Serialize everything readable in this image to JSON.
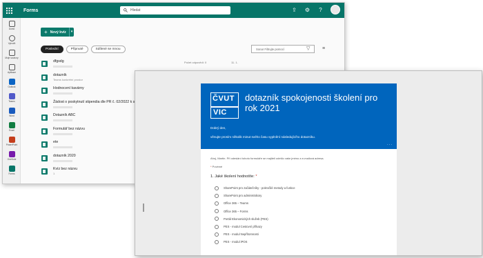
{
  "back_window": {
    "app_name": "Forms",
    "search_placeholder": "Hledat",
    "top_icons": [
      "share-icon",
      "gear-icon",
      "help-icon"
    ],
    "left_rail": [
      {
        "label": "Domů",
        "icon": "home-icon"
      },
      {
        "label": "Vytvořit",
        "icon": "create-icon"
      },
      {
        "label": "Moje soubory",
        "icon": "folder-icon"
      },
      {
        "label": "Aplikace",
        "icon": "apps-icon"
      },
      {
        "label": "Outlook",
        "icon": "outlook-icon"
      },
      {
        "label": "Teams",
        "icon": "teams-icon"
      },
      {
        "label": "Word",
        "icon": "word-icon"
      },
      {
        "label": "Excel",
        "icon": "excel-icon"
      },
      {
        "label": "PowerPoint",
        "icon": "powerpoint-icon"
      },
      {
        "label": "OneNote",
        "icon": "onenote-icon"
      },
      {
        "label": "Forms",
        "icon": "forms-icon"
      }
    ],
    "new_button_label": "Nový kvíz",
    "filters": [
      "Poslední",
      "Připnuté",
      "Sdílené se mnou"
    ],
    "filter_search_placeholder": "Son​ar Filtrujte pomocí",
    "rows": [
      {
        "title": "dfgsdg",
        "sub": "",
        "responses": "Počet odpovědí: 0",
        "date": "11. 1."
      },
      {
        "title": "dotazník",
        "sub": "Teams konkrétní prostor",
        "responses": "",
        "date": ""
      },
      {
        "title": "Hodnocení kavárny",
        "sub": "",
        "responses": "",
        "date": ""
      },
      {
        "title": "Žádost o poskytnutí stipendia dle PR č. 02/2022 k s",
        "sub": "",
        "responses": "",
        "date": ""
      },
      {
        "title": "Dotazník ABC",
        "sub": "",
        "responses": "",
        "date": ""
      },
      {
        "title": "Formulář bez názvu",
        "sub": "",
        "responses": "",
        "date": ""
      },
      {
        "title": "ete",
        "sub": "",
        "responses": "",
        "date": ""
      },
      {
        "title": "dotazník 2020",
        "sub": "",
        "responses": "",
        "date": ""
      },
      {
        "title": "Kvíz bez názvu",
        "sub": "1",
        "responses": "",
        "date": ""
      }
    ],
    "colors": {
      "brand": "#077568",
      "accent": "#0b7a6b"
    }
  },
  "front_window": {
    "logo_top": "ČVUT",
    "logo_bottom": "VIC",
    "title": "dotazník spokojenosti školení pro rok 2021",
    "greeting": "Dobrý den,",
    "intro": "věnujte prosím několik minut svého času vyplnění následujícího dotazníku.",
    "notice": "Ahoj, Martin. Při odeslání tohoto formuláře se majiteli odešlo vaše jméno a e-mailová adresa.",
    "required_note": "Povinné",
    "question": "1. Jaké školení hodnotíte: ",
    "options": [
      "SharePoint pro začátečníky - pokročilé metody a funkce",
      "SharePoint pro administrátory",
      "Office 365 – Teams",
      "Office 365 – Forms",
      "Portál Ekonomických služeb (PES)",
      "PES - modul Cestovní příkazy",
      "PES - modul Nepřítomnosti",
      "PES - modul iPOS"
    ],
    "colors": {
      "header": "#0065bd",
      "required": "#c43a2b"
    }
  }
}
